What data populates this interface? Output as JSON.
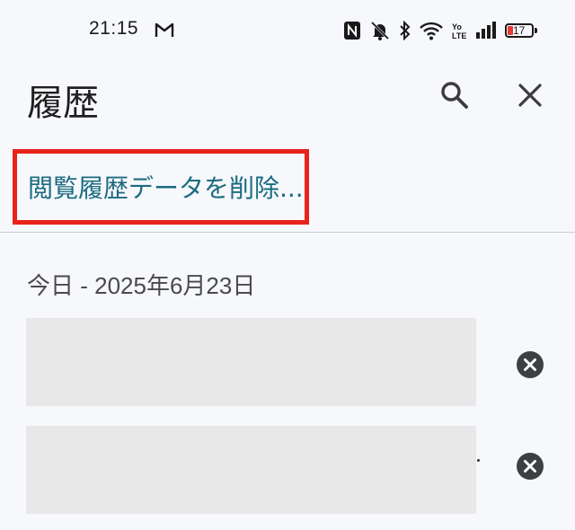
{
  "status_bar": {
    "time": "21:15",
    "battery_level": "17",
    "icons": [
      "gmail-icon",
      "nfc-icon",
      "mute-icon",
      "bluetooth-icon",
      "wifi-icon",
      "volte-icon",
      "signal-icon",
      "battery-icon"
    ]
  },
  "app_bar": {
    "title": "履歴",
    "search_icon": "search-icon",
    "close_icon": "close-icon"
  },
  "clear_data": {
    "label": "閲覧履歴データを削除..."
  },
  "history": {
    "date_header": "今日 - 2025年6月23日",
    "items": [
      {
        "remove_icon": "remove-circle-icon"
      },
      {
        "remove_icon": "remove-circle-icon"
      }
    ]
  },
  "colors": {
    "background": "#f6f8fc",
    "link": "#1c6b7f",
    "highlight_border": "#e8231b",
    "battery_low": "#e53935",
    "placeholder": "#e8e8e8"
  }
}
